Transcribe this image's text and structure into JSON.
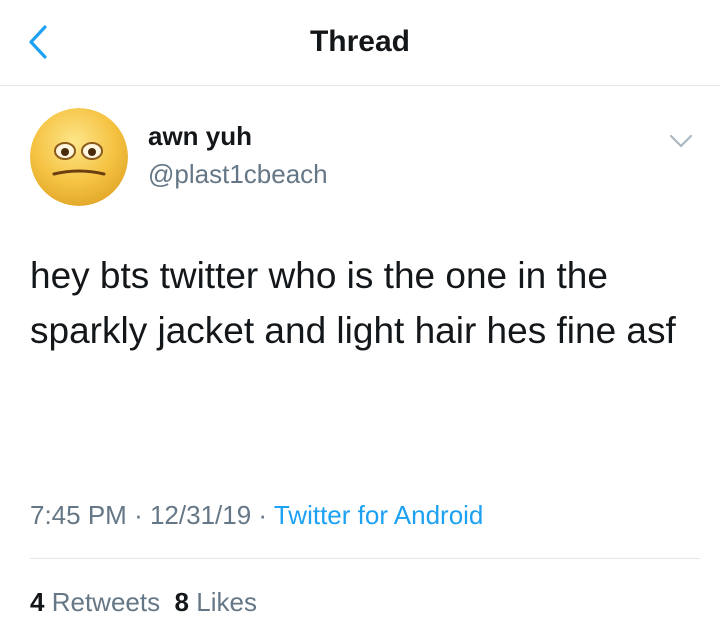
{
  "header": {
    "title": "Thread",
    "back_icon": "chevron-left-icon"
  },
  "tweet": {
    "author": {
      "name": "awn yuh",
      "handle": "@plast1cbeach",
      "avatar": "emoji-face-icon"
    },
    "menu_icon": "chevron-down-icon",
    "text": "hey bts twitter who is the one in the sparkly jacket and light hair hes fine asf",
    "time": "7:45 PM",
    "date": "12/31/19",
    "separator": "·",
    "source": "Twitter for Android",
    "retweets": {
      "count": "4",
      "label": "Retweets"
    },
    "likes": {
      "count": "8",
      "label": "Likes"
    }
  },
  "colors": {
    "accent": "#1da1f2",
    "text": "#14171a",
    "muted": "#657786",
    "divider": "#e1e8ed"
  }
}
